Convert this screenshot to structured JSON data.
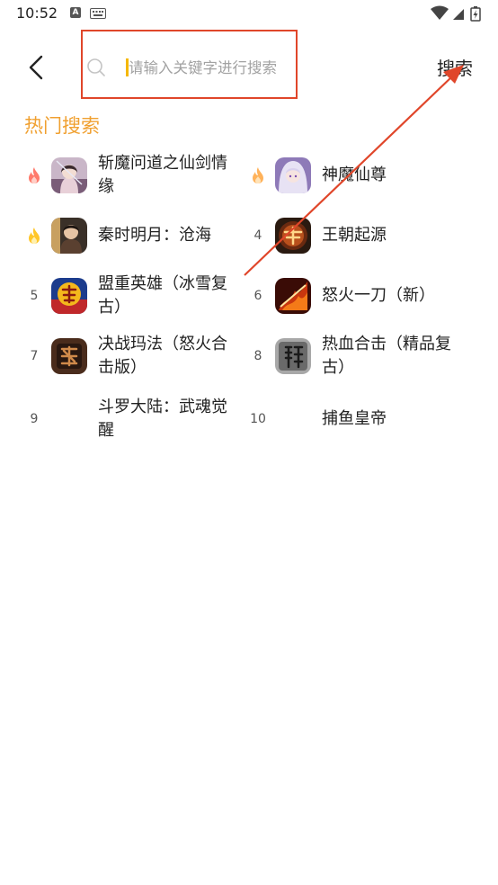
{
  "status_bar": {
    "time": "10:52",
    "a_icon_label": "A"
  },
  "header": {
    "search_placeholder": "请输入关键字进行搜索",
    "search_value": "",
    "search_button_label": "搜索"
  },
  "section": {
    "title": "热门搜索"
  },
  "hot_items": [
    {
      "rank": "",
      "rank_icon": "flame-red-icon",
      "name": "斩魔问道之仙剑情缘",
      "thumb": "swordswoman-thumbnail"
    },
    {
      "rank": "",
      "rank_icon": "flame-orange-icon",
      "name": "神魔仙尊",
      "thumb": "white-hair-girl-thumbnail"
    },
    {
      "rank": "",
      "rank_icon": "flame-yellow-icon",
      "name": "秦时明月：沧海",
      "thumb": "warrior-thumbnail"
    },
    {
      "rank": "4",
      "rank_icon": "",
      "name": "王朝起源",
      "thumb": "dynasty-logo-thumbnail"
    },
    {
      "rank": "5",
      "rank_icon": "",
      "name": "盟重英雄（冰雪复古）",
      "thumb": "legend-logo-thumbnail"
    },
    {
      "rank": "6",
      "rank_icon": "",
      "name": "怒火一刀（新）",
      "thumb": "fire-blade-thumbnail"
    },
    {
      "rank": "7",
      "rank_icon": "",
      "name": "决战玛法（怒火合击版）",
      "thumb": "dragon-calligraphy-thumbnail"
    },
    {
      "rank": "8",
      "rank_icon": "",
      "name": "热血合击（精品复古）",
      "thumb": "long-character-thumbnail"
    },
    {
      "rank": "9",
      "rank_icon": "",
      "name": "斗罗大陆：武魂觉醒",
      "thumb": ""
    },
    {
      "rank": "10",
      "rank_icon": "",
      "name": "捕鱼皇帝",
      "thumb": ""
    }
  ],
  "colors": {
    "section_title": "#f0a030",
    "cursor": "#f5b800",
    "annotation": "#e0462a"
  }
}
